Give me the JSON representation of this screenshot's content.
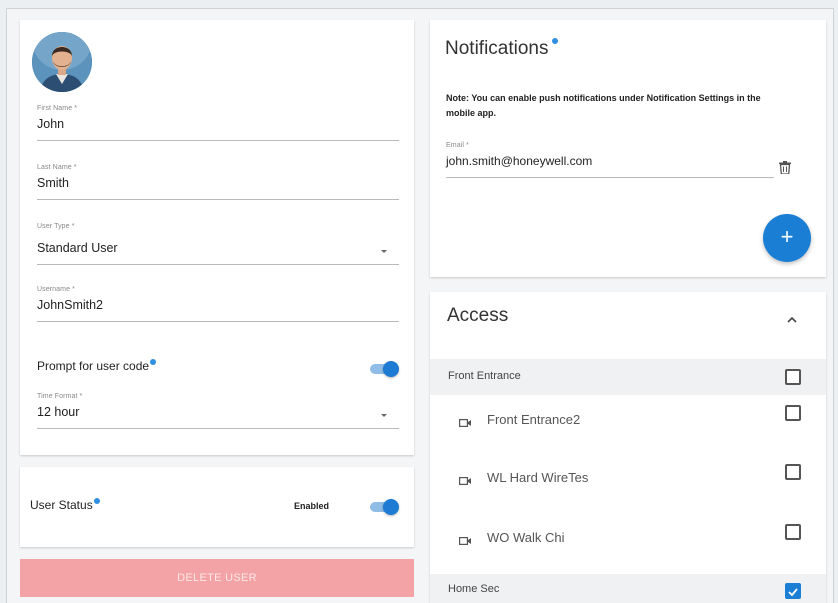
{
  "profile": {
    "first_name_label": "First Name *",
    "first_name_value": "John",
    "last_name_label": "Last Name *",
    "last_name_value": "Smith",
    "user_type_label": "User Type *",
    "user_type_value": "Standard User",
    "username_label": "Username *",
    "username_value": "JohnSmith2",
    "prompt_user_code_label": "Prompt for user code",
    "prompt_user_code_on": true,
    "time_format_label": "Time Format *",
    "time_format_value": "12 hour"
  },
  "status": {
    "label": "User Status",
    "value": "Enabled",
    "enabled": true
  },
  "delete_button": "DELETE USER",
  "notifications": {
    "title": "Notifications",
    "note": "Note: You can enable push notifications under Notification Settings in the mobile app.",
    "email_label": "Email *",
    "email_value": "john.smith@honeywell.com",
    "add_label": "+"
  },
  "access": {
    "title": "Access",
    "groups": [
      {
        "name": "Front Entrance",
        "checked": false,
        "children": [
          {
            "name": "Front Entrance2",
            "checked": false
          },
          {
            "name": "WL Hard WireTes",
            "checked": false
          },
          {
            "name": "WO Walk Chi",
            "checked": false
          }
        ]
      },
      {
        "name": "Home Sec",
        "checked": true,
        "children": []
      }
    ]
  },
  "icons": {
    "trash": "trash-icon",
    "camera": "camera-icon",
    "chevron": "chevron-up-icon",
    "info_dot": "info-dot-icon"
  },
  "colors": {
    "accent": "#1a7ed4",
    "delete_button_bg": "#f3a3a5",
    "group_row_bg": "#f0f1f3"
  }
}
